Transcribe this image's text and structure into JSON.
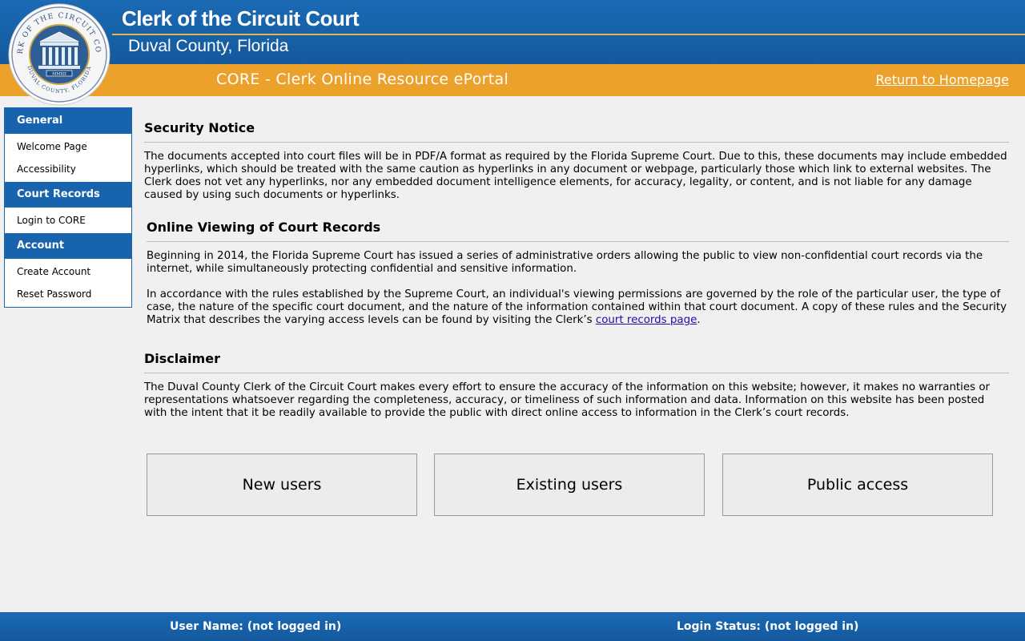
{
  "header": {
    "title": "Clerk of the Circuit Court",
    "subtitle": "Duval County, Florida",
    "portal_title": "CORE - Clerk Online Resource ePortal",
    "home_link": "Return to Homepage",
    "seal": {
      "outer_text": "CLERK OF THE CIRCUIT COURT",
      "inner_text": "DUVAL COUNTY, FLORIDA",
      "year": "MMXII"
    }
  },
  "sidebar": {
    "sections": [
      {
        "title": "General",
        "items": [
          "Welcome Page",
          "Accessibility"
        ]
      },
      {
        "title": "Court Records",
        "items": [
          "Login to CORE"
        ]
      },
      {
        "title": "Account",
        "items": [
          "Create Account",
          "Reset Password"
        ]
      }
    ]
  },
  "main": {
    "security": {
      "heading": "Security Notice",
      "text": "The documents accepted into court files will be in PDF/A format as required by the Florida Supreme Court. Due to this, these documents may include embedded hyperlinks, which should be treated with the same caution as hyperlinks in any document or webpage, particularly those which link to external websites. The Clerk does not vet any hyperlinks, nor any embedded document intelligence elements, for accuracy, legality, or content, and is not liable for any damage caused by using such documents or hyperlinks."
    },
    "viewing": {
      "heading": "Online Viewing of Court Records",
      "text1": "Beginning in 2014, the Florida Supreme Court has issued a series of administrative orders allowing the public to view non-confidential court records via the internet, while simultaneously protecting confidential and sensitive information.",
      "text2_before": "In accordance with the rules established by the Supreme Court, an individual's viewing permissions are governed by the role of the particular user, the type of case, the nature of the specific court document, and the nature of the information contained within that court document. A copy of these rules and the Security Matrix that describes the varying access levels can be found by visiting the Clerk’s ",
      "text2_link": "court records page",
      "text2_after": "."
    },
    "disclaimer": {
      "heading": "Disclaimer",
      "text": "The Duval County Clerk of the Circuit Court makes every effort to ensure the accuracy of the information on this website; however, it makes no warranties or representations whatsoever regarding the completeness, accuracy, or timeliness of such information and data. Information on this website has been posted with the intent that it be readily available to provide the public with direct online access to information in the Clerk’s court records."
    },
    "buttons": [
      "New users",
      "Existing users",
      "Public access"
    ]
  },
  "footer": {
    "user_name": "User Name: (not logged in)",
    "login_status": "Login Status: (not logged in)"
  },
  "colors": {
    "blue": "#1763ae",
    "orange": "#eba12a",
    "gold_rule": "#e9b64a",
    "link": "#1a0dab"
  }
}
